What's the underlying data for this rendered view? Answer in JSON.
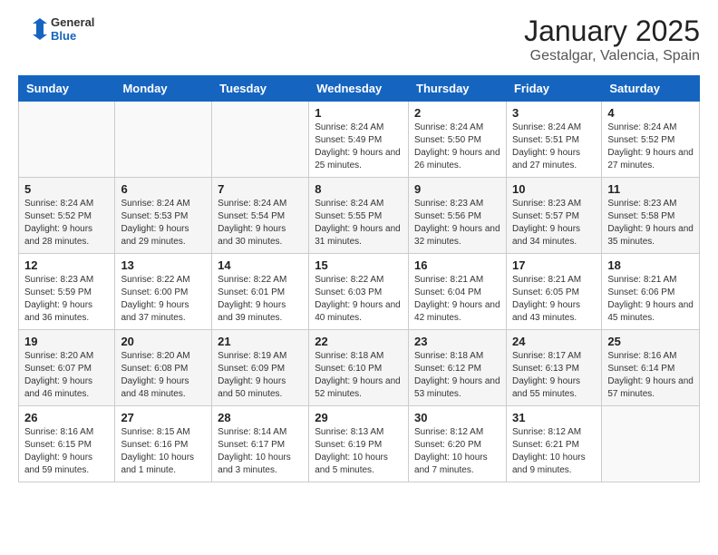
{
  "header": {
    "logo_general": "General",
    "logo_blue": "Blue",
    "month_title": "January 2025",
    "location": "Gestalgar, Valencia, Spain"
  },
  "weekdays": [
    "Sunday",
    "Monday",
    "Tuesday",
    "Wednesday",
    "Thursday",
    "Friday",
    "Saturday"
  ],
  "weeks": [
    [
      {
        "day": "",
        "info": ""
      },
      {
        "day": "",
        "info": ""
      },
      {
        "day": "",
        "info": ""
      },
      {
        "day": "1",
        "info": "Sunrise: 8:24 AM\nSunset: 5:49 PM\nDaylight: 9 hours and 25 minutes."
      },
      {
        "day": "2",
        "info": "Sunrise: 8:24 AM\nSunset: 5:50 PM\nDaylight: 9 hours and 26 minutes."
      },
      {
        "day": "3",
        "info": "Sunrise: 8:24 AM\nSunset: 5:51 PM\nDaylight: 9 hours and 27 minutes."
      },
      {
        "day": "4",
        "info": "Sunrise: 8:24 AM\nSunset: 5:52 PM\nDaylight: 9 hours and 27 minutes."
      }
    ],
    [
      {
        "day": "5",
        "info": "Sunrise: 8:24 AM\nSunset: 5:52 PM\nDaylight: 9 hours and 28 minutes."
      },
      {
        "day": "6",
        "info": "Sunrise: 8:24 AM\nSunset: 5:53 PM\nDaylight: 9 hours and 29 minutes."
      },
      {
        "day": "7",
        "info": "Sunrise: 8:24 AM\nSunset: 5:54 PM\nDaylight: 9 hours and 30 minutes."
      },
      {
        "day": "8",
        "info": "Sunrise: 8:24 AM\nSunset: 5:55 PM\nDaylight: 9 hours and 31 minutes."
      },
      {
        "day": "9",
        "info": "Sunrise: 8:23 AM\nSunset: 5:56 PM\nDaylight: 9 hours and 32 minutes."
      },
      {
        "day": "10",
        "info": "Sunrise: 8:23 AM\nSunset: 5:57 PM\nDaylight: 9 hours and 34 minutes."
      },
      {
        "day": "11",
        "info": "Sunrise: 8:23 AM\nSunset: 5:58 PM\nDaylight: 9 hours and 35 minutes."
      }
    ],
    [
      {
        "day": "12",
        "info": "Sunrise: 8:23 AM\nSunset: 5:59 PM\nDaylight: 9 hours and 36 minutes."
      },
      {
        "day": "13",
        "info": "Sunrise: 8:22 AM\nSunset: 6:00 PM\nDaylight: 9 hours and 37 minutes."
      },
      {
        "day": "14",
        "info": "Sunrise: 8:22 AM\nSunset: 6:01 PM\nDaylight: 9 hours and 39 minutes."
      },
      {
        "day": "15",
        "info": "Sunrise: 8:22 AM\nSunset: 6:03 PM\nDaylight: 9 hours and 40 minutes."
      },
      {
        "day": "16",
        "info": "Sunrise: 8:21 AM\nSunset: 6:04 PM\nDaylight: 9 hours and 42 minutes."
      },
      {
        "day": "17",
        "info": "Sunrise: 8:21 AM\nSunset: 6:05 PM\nDaylight: 9 hours and 43 minutes."
      },
      {
        "day": "18",
        "info": "Sunrise: 8:21 AM\nSunset: 6:06 PM\nDaylight: 9 hours and 45 minutes."
      }
    ],
    [
      {
        "day": "19",
        "info": "Sunrise: 8:20 AM\nSunset: 6:07 PM\nDaylight: 9 hours and 46 minutes."
      },
      {
        "day": "20",
        "info": "Sunrise: 8:20 AM\nSunset: 6:08 PM\nDaylight: 9 hours and 48 minutes."
      },
      {
        "day": "21",
        "info": "Sunrise: 8:19 AM\nSunset: 6:09 PM\nDaylight: 9 hours and 50 minutes."
      },
      {
        "day": "22",
        "info": "Sunrise: 8:18 AM\nSunset: 6:10 PM\nDaylight: 9 hours and 52 minutes."
      },
      {
        "day": "23",
        "info": "Sunrise: 8:18 AM\nSunset: 6:12 PM\nDaylight: 9 hours and 53 minutes."
      },
      {
        "day": "24",
        "info": "Sunrise: 8:17 AM\nSunset: 6:13 PM\nDaylight: 9 hours and 55 minutes."
      },
      {
        "day": "25",
        "info": "Sunrise: 8:16 AM\nSunset: 6:14 PM\nDaylight: 9 hours and 57 minutes."
      }
    ],
    [
      {
        "day": "26",
        "info": "Sunrise: 8:16 AM\nSunset: 6:15 PM\nDaylight: 9 hours and 59 minutes."
      },
      {
        "day": "27",
        "info": "Sunrise: 8:15 AM\nSunset: 6:16 PM\nDaylight: 10 hours and 1 minute."
      },
      {
        "day": "28",
        "info": "Sunrise: 8:14 AM\nSunset: 6:17 PM\nDaylight: 10 hours and 3 minutes."
      },
      {
        "day": "29",
        "info": "Sunrise: 8:13 AM\nSunset: 6:19 PM\nDaylight: 10 hours and 5 minutes."
      },
      {
        "day": "30",
        "info": "Sunrise: 8:12 AM\nSunset: 6:20 PM\nDaylight: 10 hours and 7 minutes."
      },
      {
        "day": "31",
        "info": "Sunrise: 8:12 AM\nSunset: 6:21 PM\nDaylight: 10 hours and 9 minutes."
      },
      {
        "day": "",
        "info": ""
      }
    ]
  ]
}
